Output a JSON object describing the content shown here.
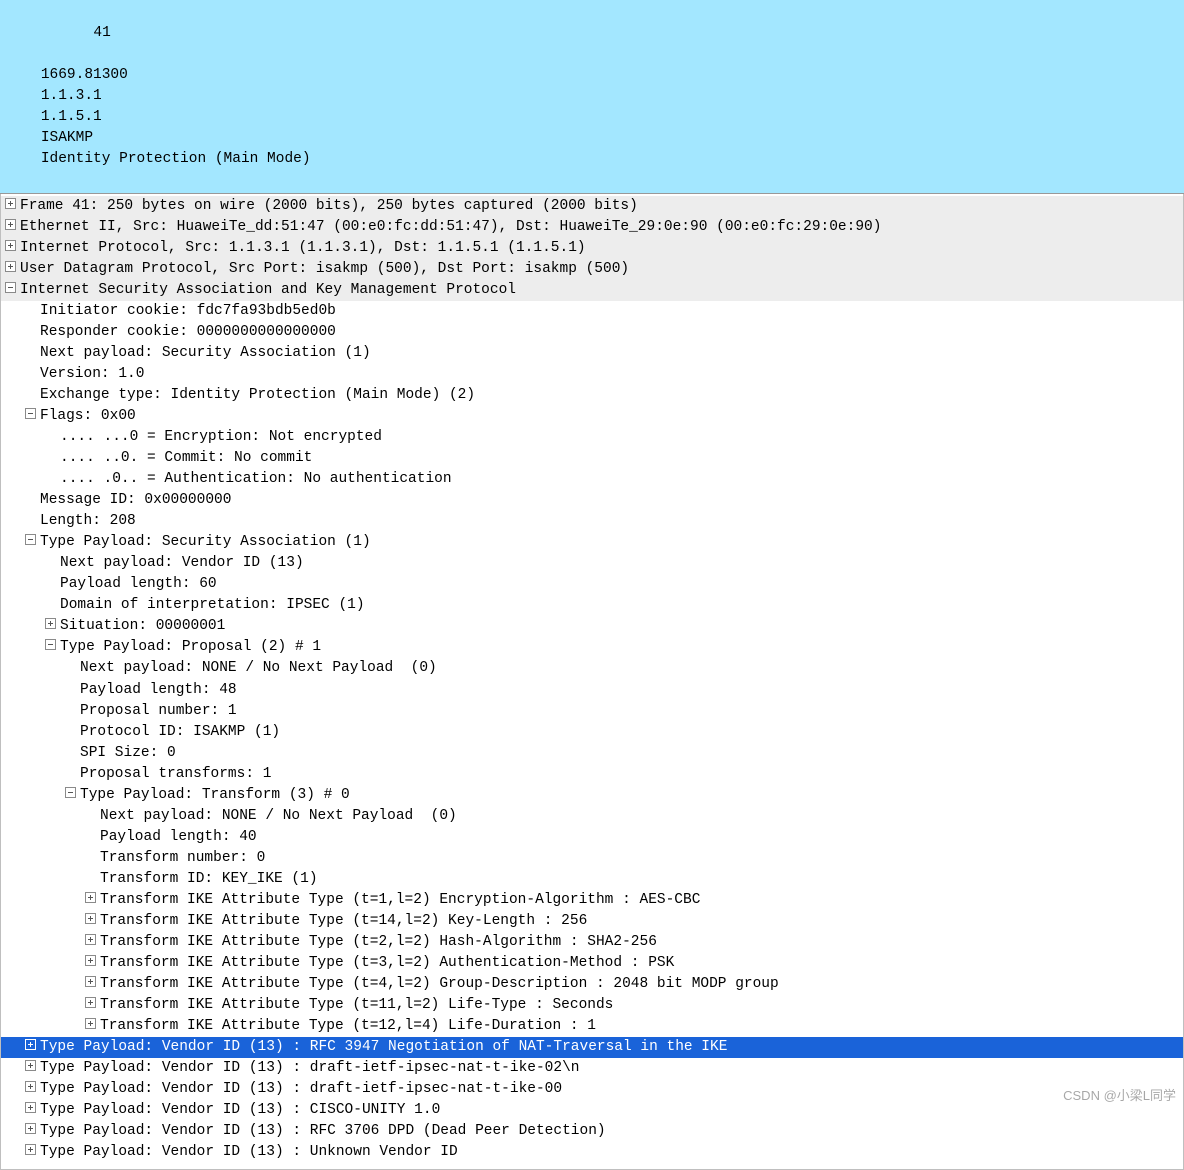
{
  "packet_list": {
    "rows": [
      {
        "no": "41",
        "time": "1669.81300",
        "src": "1.1.3.1",
        "dst": "1.1.5.1",
        "proto": "ISAKMP",
        "info": "Identity Protection (Main Mode)"
      }
    ]
  },
  "details": {
    "frame": "Frame 41: 250 bytes on wire (2000 bits), 250 bytes captured (2000 bits)",
    "eth": "Ethernet II, Src: HuaweiTe_dd:51:47 (00:e0:fc:dd:51:47), Dst: HuaweiTe_29:0e:90 (00:e0:fc:29:0e:90)",
    "ip": "Internet Protocol, Src: 1.1.3.1 (1.1.3.1), Dst: 1.1.5.1 (1.1.5.1)",
    "udp": "User Datagram Protocol, Src Port: isakmp (500), Dst Port: isakmp (500)",
    "isakmp": "Internet Security Association and Key Management Protocol",
    "fields": {
      "init_cookie": "Initiator cookie: fdc7fa93bdb5ed0b",
      "resp_cookie": "Responder cookie: 0000000000000000",
      "next_payload": "Next payload: Security Association (1)",
      "version": "Version: 1.0",
      "exch": "Exchange type: Identity Protection (Main Mode) (2)",
      "flags": "Flags: 0x00",
      "flag_enc": ".... ...0 = Encryption: Not encrypted",
      "flag_commit": ".... ..0. = Commit: No commit",
      "flag_auth": ".... .0.. = Authentication: No authentication",
      "msg_id": "Message ID: 0x00000000",
      "length": "Length: 208"
    },
    "sa": {
      "title": "Type Payload: Security Association (1)",
      "np": "Next payload: Vendor ID (13)",
      "plen": "Payload length: 60",
      "doi": "Domain of interpretation: IPSEC (1)",
      "situ": "Situation: 00000001",
      "prop": {
        "title": "Type Payload: Proposal (2) # 1",
        "np": "Next payload: NONE / No Next Payload  (0)",
        "plen": "Payload length: 48",
        "pnum": "Proposal number: 1",
        "pid": "Protocol ID: ISAKMP (1)",
        "spi": "SPI Size: 0",
        "ptr": "Proposal transforms: 1",
        "xf": {
          "title": "Type Payload: Transform (3) # 0",
          "np": "Next payload: NONE / No Next Payload  (0)",
          "plen": "Payload length: 40",
          "tnum": "Transform number: 0",
          "tid": "Transform ID: KEY_IKE (1)",
          "attrs": [
            "Transform IKE Attribute Type (t=1,l=2) Encryption-Algorithm : AES-CBC",
            "Transform IKE Attribute Type (t=14,l=2) Key-Length : 256",
            "Transform IKE Attribute Type (t=2,l=2) Hash-Algorithm : SHA2-256",
            "Transform IKE Attribute Type (t=3,l=2) Authentication-Method : PSK",
            "Transform IKE Attribute Type (t=4,l=2) Group-Description : 2048 bit MODP group",
            "Transform IKE Attribute Type (t=11,l=2) Life-Type : Seconds",
            "Transform IKE Attribute Type (t=12,l=4) Life-Duration : 1"
          ]
        }
      }
    },
    "vendors": [
      "Type Payload: Vendor ID (13) : RFC 3947 Negotiation of NAT-Traversal in the IKE",
      "Type Payload: Vendor ID (13) : draft-ietf-ipsec-nat-t-ike-02\\n",
      "Type Payload: Vendor ID (13) : draft-ietf-ipsec-nat-t-ike-00",
      "Type Payload: Vendor ID (13) : CISCO-UNITY 1.0",
      "Type Payload: Vendor ID (13) : RFC 3706 DPD (Dead Peer Detection)",
      "Type Payload: Vendor ID (13) : Unknown Vendor ID"
    ]
  },
  "watermark": "CSDN @小梁L同学"
}
